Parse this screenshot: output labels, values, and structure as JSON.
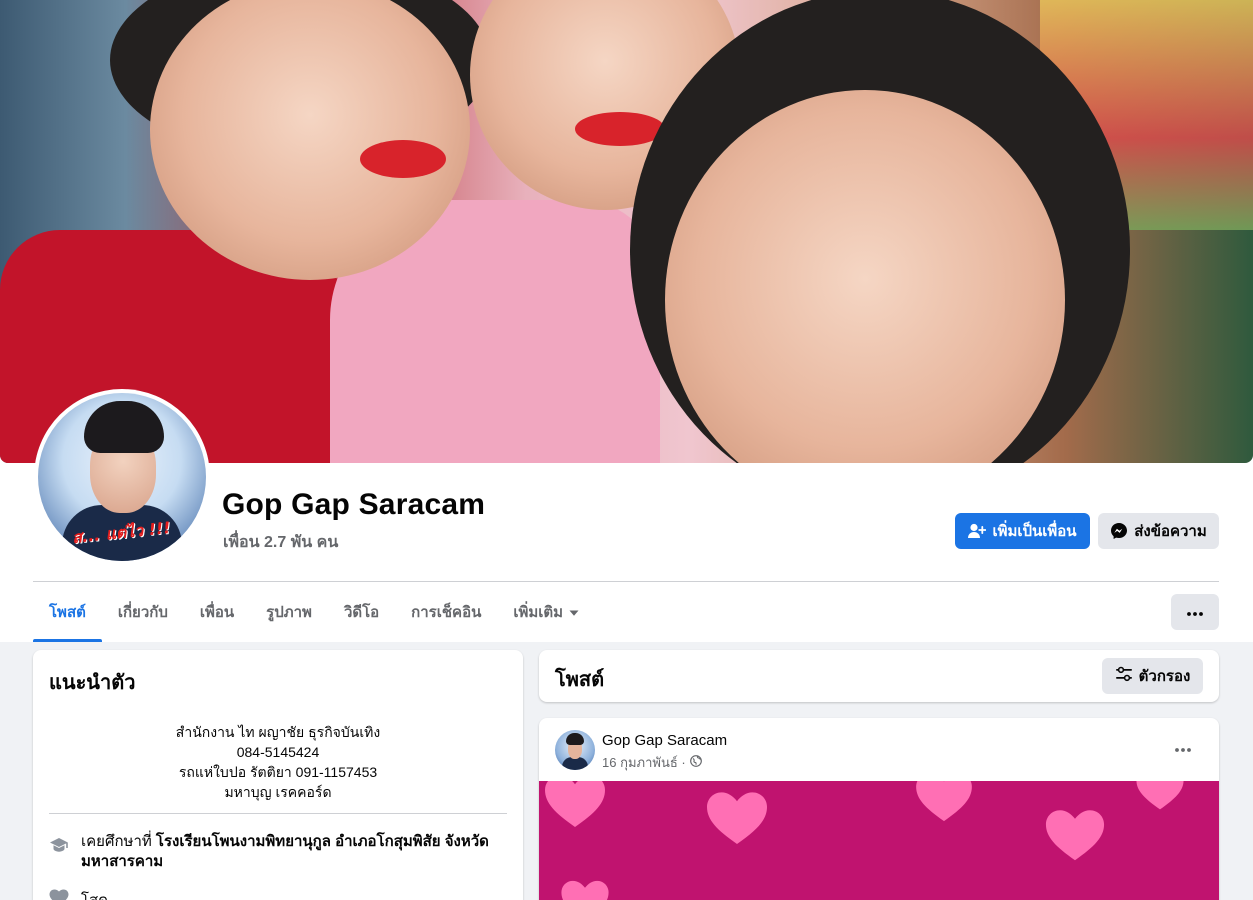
{
  "profile": {
    "name": "Gop Gap Saracam",
    "friends": "เพื่อน 2.7 พัน คน",
    "avatar_text": "ส... แต่ไว !!!"
  },
  "actions": {
    "add_friend": "เพิ่มเป็นเพื่อน",
    "message": "ส่งข้อความ"
  },
  "tabs": [
    {
      "label": "โพสต์",
      "active": true
    },
    {
      "label": "เกี่ยวกับ",
      "active": false
    },
    {
      "label": "เพื่อน",
      "active": false
    },
    {
      "label": "รูปภาพ",
      "active": false
    },
    {
      "label": "วิดีโอ",
      "active": false
    },
    {
      "label": "การเช็คอิน",
      "active": false
    },
    {
      "label": "เพิ่มเติม",
      "active": false
    }
  ],
  "intro": {
    "title": "แนะนำตัว",
    "bio_lines": [
      "สำนักงาน ไท ผญาชัย ธุรกิจบันเทิง",
      "084-5145424",
      "รถแห่ใบปอ รัตติยา 091-1157453",
      "มหาบุญ เรคคอร์ด"
    ],
    "education_prefix": "เคยศึกษาที่ ",
    "education_school": "โรงเรียนโพนงามพิทยานุกูล อำเภอโกสุมพิสัย จังหวัดมหาสารคาม",
    "relationship": "โสด"
  },
  "posts": {
    "title": "โพสต์",
    "filter_label": "ตัวกรอง"
  },
  "post": {
    "author": "Gop Gap Saracam",
    "date": "16 กุมภาพันธ์ ·",
    "media_bg": "#c0136f",
    "heart_color": "#ff6fb4"
  },
  "colors": {
    "accent": "#1b74e4",
    "secondary_button": "#e4e6eb",
    "page_bg": "#f0f2f5",
    "muted_text": "#65676b"
  }
}
